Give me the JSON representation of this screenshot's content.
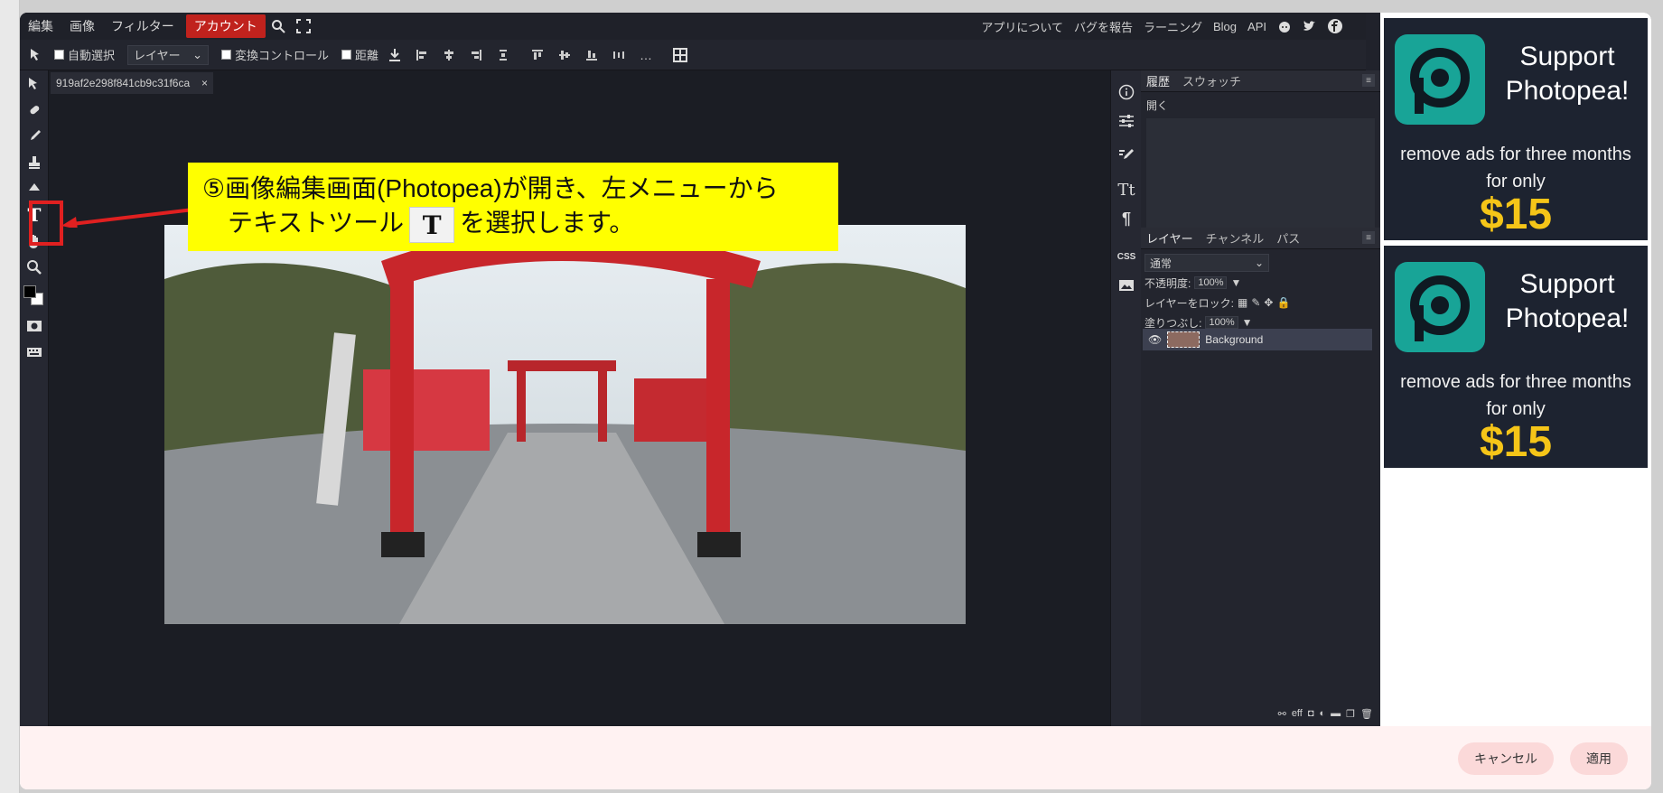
{
  "menubar": {
    "items": [
      "編集",
      "画像",
      "フィルター",
      "アカウント"
    ],
    "right_links": [
      "アプリについて",
      "バグを報告",
      "ラーニング",
      "Blog",
      "API"
    ]
  },
  "options": {
    "auto_select": "自動選択",
    "layer_select": "レイヤー",
    "transform_controls": "変換コントロール",
    "distance": "距離"
  },
  "document": {
    "tab_name": "919af2e298f841cb9c31f6ca",
    "close": "×"
  },
  "panels": {
    "history_tabs": [
      "履歴",
      "スウォッチ"
    ],
    "history_items": [
      "開く"
    ],
    "layer_tabs": [
      "レイヤー",
      "チャンネル",
      "パス"
    ],
    "blend_mode": "通常",
    "opacity_label": "不透明度:",
    "opacity_value": "100%",
    "lock_label": "レイヤーをロック:",
    "fill_label": "塗りつぶし:",
    "fill_value": "100%",
    "layer_name": "Background",
    "footer_text": "eff"
  },
  "sidestrip": {
    "css_label": "CSS"
  },
  "ads": [
    {
      "title": "Support Photopea!",
      "subtitle": "remove ads for three months for only",
      "price": "$15"
    },
    {
      "title": "Support Photopea!",
      "subtitle": "remove ads for three months for only",
      "price": "$15"
    }
  ],
  "footer": {
    "cancel": "キャンセル",
    "apply": "適用"
  },
  "callout": {
    "line1": "⑤画像編集画面(Photopea)が開き、左メニューから",
    "line2_before": "テキストツール",
    "chip": "T",
    "line2_after": "を選択します。"
  },
  "colors": {
    "accent_red": "#c0221d",
    "callout_yellow": "#ffff00",
    "highlight_red": "#e02020",
    "photopea_teal": "#18a497",
    "price_gold": "#f5c518"
  }
}
